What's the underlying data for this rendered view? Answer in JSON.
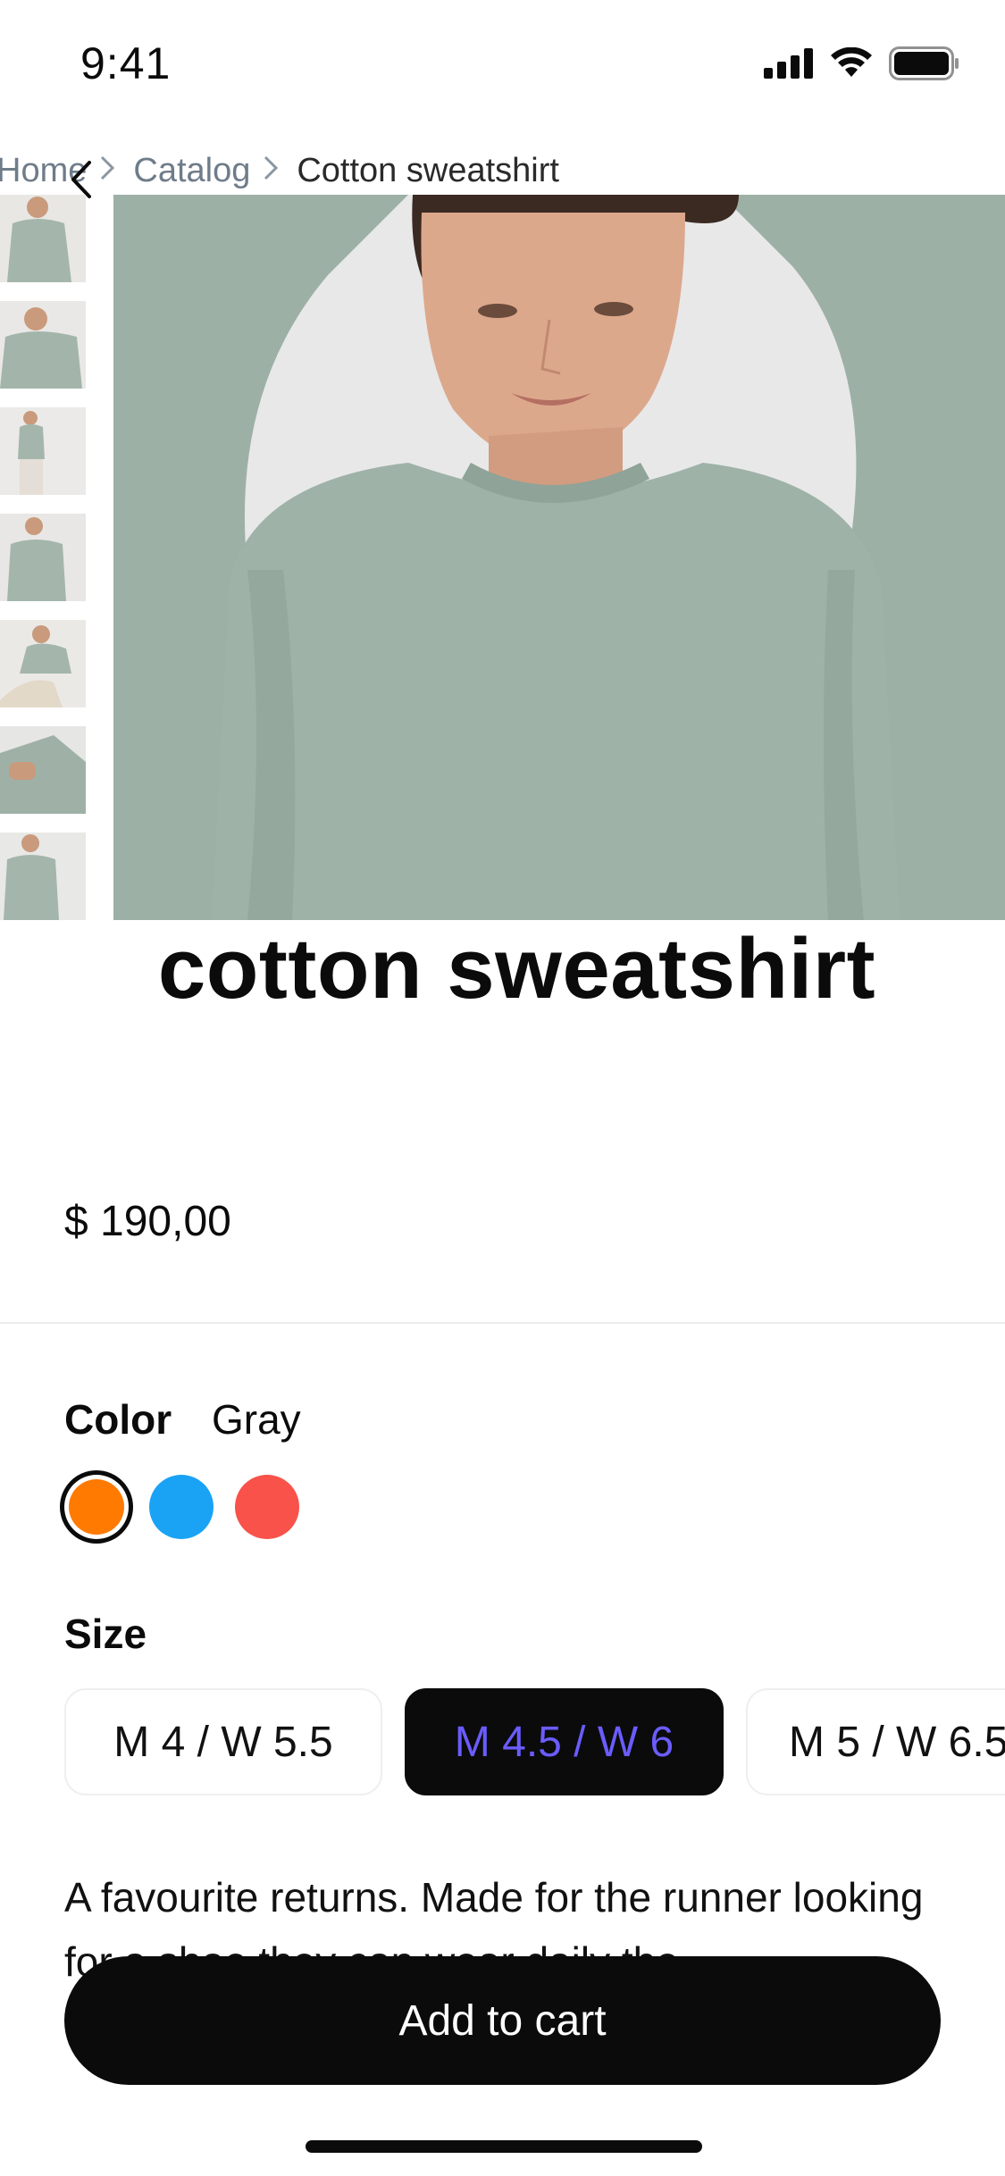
{
  "status_bar": {
    "time": "9:41"
  },
  "breadcrumb": {
    "items": [
      "Home",
      "Catalog",
      "Cotton sweatshirt"
    ]
  },
  "product": {
    "title": "cotton sweatshirt",
    "price": "$ 190,00",
    "color_label": "Color",
    "color_value": "Gray",
    "colors": [
      "#ff7a00",
      "#1aa3f5",
      "#f8524a"
    ],
    "size_label": "Size",
    "sizes": [
      "M 4 / W 5.5",
      "M 4.5 / W 6",
      "M 5 / W 6.5"
    ],
    "selected_size": "M 4.5 / W 6",
    "description": "A favourite returns. Made for the runner looking for a shoe they can wear daily the"
  },
  "actions": {
    "add_to_cart": "Add to cart"
  },
  "theme": {
    "accent": "#6a5cff",
    "text": "#0b0b0b",
    "sweatshirt": "#9fb2a7"
  }
}
